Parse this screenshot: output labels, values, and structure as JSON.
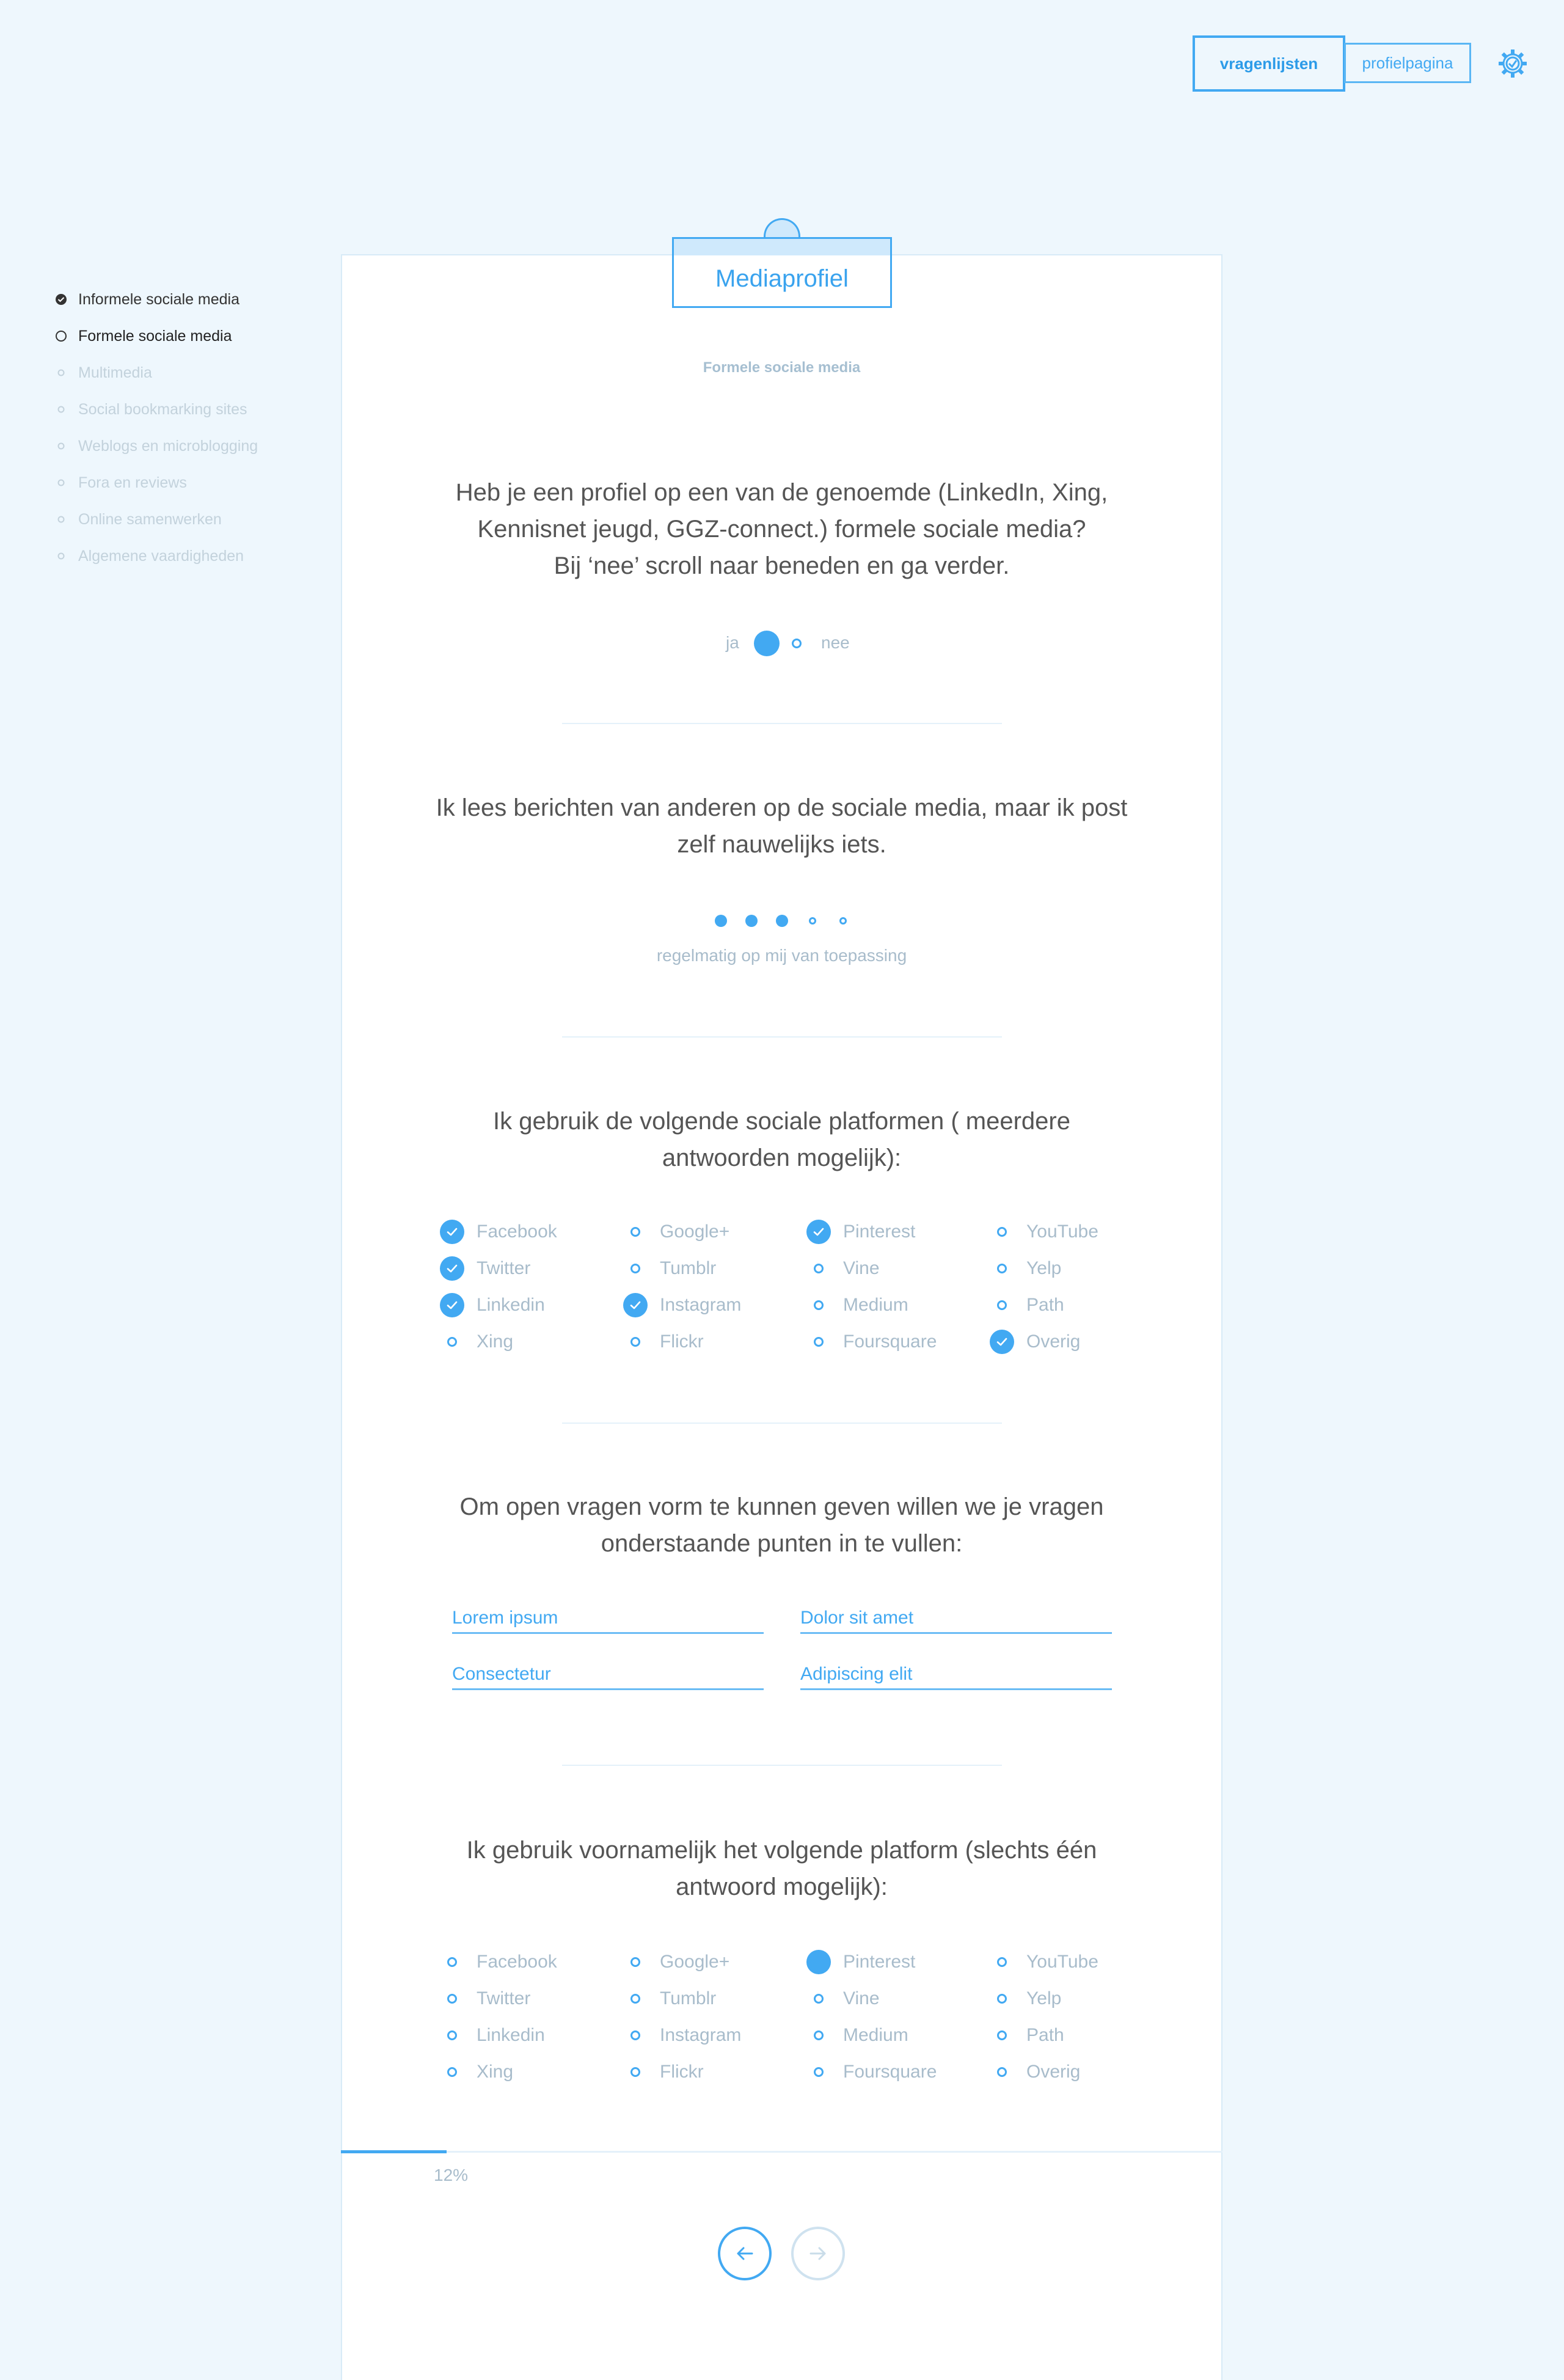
{
  "nav": {
    "vragenlijsten": "vragenlijsten",
    "profielpagina": "profielpagina",
    "settings_icon": "gear-icon"
  },
  "sidebar": {
    "items": [
      {
        "label": "Informele sociale media",
        "state": "done"
      },
      {
        "label": "Formele sociale media",
        "state": "active"
      },
      {
        "label": "Multimedia",
        "state": "todo"
      },
      {
        "label": "Social bookmarking sites",
        "state": "todo"
      },
      {
        "label": "Weblogs en microblogging",
        "state": "todo"
      },
      {
        "label": "Fora en reviews",
        "state": "todo"
      },
      {
        "label": "Online samenwerken",
        "state": "todo"
      },
      {
        "label": "Algemene vaardigheden",
        "state": "todo"
      }
    ]
  },
  "card": {
    "tab_title": "Mediaprofiel",
    "subtitle": "Formele sociale media"
  },
  "q1": {
    "line1": "Heb je een profiel op een van de genoemde (LinkedIn, Xing,",
    "line2": "Kennisnet jeugd, GGZ-connect.) formele sociale media?",
    "line3": "Bij ‘nee’ scroll naar beneden en ga verder.",
    "yes": "ja",
    "no": "nee",
    "selected": "ja"
  },
  "q2": {
    "line1": "Ik lees berichten van anderen op de sociale media, maar ik post",
    "line2": "zelf nauwelijks iets.",
    "scale_value": 3,
    "scale_max": 5,
    "scale_label": "regelmatig op mij van toepassing"
  },
  "q3": {
    "line1": "Ik gebruik de volgende sociale platformen ( meerdere",
    "line2": "antwoorden mogelijk):",
    "options": [
      {
        "label": "Facebook",
        "checked": true
      },
      {
        "label": "Twitter",
        "checked": true
      },
      {
        "label": "Linkedin",
        "checked": true
      },
      {
        "label": "Xing",
        "checked": false
      },
      {
        "label": "Google+",
        "checked": false
      },
      {
        "label": "Tumblr",
        "checked": false
      },
      {
        "label": "Instagram",
        "checked": true
      },
      {
        "label": "Flickr",
        "checked": false
      },
      {
        "label": "Pinterest",
        "checked": true
      },
      {
        "label": "Vine",
        "checked": false
      },
      {
        "label": "Medium",
        "checked": false
      },
      {
        "label": "Foursquare",
        "checked": false
      },
      {
        "label": "YouTube",
        "checked": false
      },
      {
        "label": "Yelp",
        "checked": false
      },
      {
        "label": "Path",
        "checked": false
      },
      {
        "label": "Overig",
        "checked": true
      }
    ]
  },
  "q4": {
    "line1": "Om open vragen vorm te kunnen geven willen we je vragen",
    "line2": "onderstaande punten in te vullen:",
    "fields": [
      "Lorem ipsum",
      "Dolor sit amet",
      "Consectetur",
      "Adipiscing elit"
    ]
  },
  "q5": {
    "line1": "Ik gebruik voornamelijk het volgende platform (slechts één",
    "line2": "antwoord mogelijk):",
    "options": [
      {
        "label": "Facebook",
        "selected": false
      },
      {
        "label": "Twitter",
        "selected": false
      },
      {
        "label": "Linkedin",
        "selected": false
      },
      {
        "label": "Xing",
        "selected": false
      },
      {
        "label": "Google+",
        "selected": false
      },
      {
        "label": "Tumblr",
        "selected": false
      },
      {
        "label": "Instagram",
        "selected": false
      },
      {
        "label": "Flickr",
        "selected": false
      },
      {
        "label": "Pinterest",
        "selected": true
      },
      {
        "label": "Vine",
        "selected": false
      },
      {
        "label": "Medium",
        "selected": false
      },
      {
        "label": "Foursquare",
        "selected": false
      },
      {
        "label": "YouTube",
        "selected": false
      },
      {
        "label": "Yelp",
        "selected": false
      },
      {
        "label": "Path",
        "selected": false
      },
      {
        "label": "Overig",
        "selected": false
      }
    ]
  },
  "progress": {
    "percent": 12,
    "label": "12%"
  },
  "pager": {
    "prev_icon": "arrow-left-icon",
    "next_icon": "arrow-right-icon"
  },
  "colors": {
    "accent": "#42a9f2",
    "background": "#eef7fd",
    "muted": "#a8bccb"
  }
}
